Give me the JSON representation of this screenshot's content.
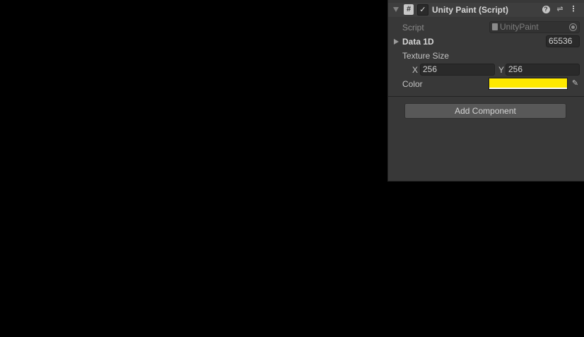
{
  "component": {
    "title": "Unity Paint (Script)",
    "enabled_check": "✓",
    "script_icon_glyph": "#",
    "help_glyph": "?",
    "presets_glyph": "⇌",
    "menu_glyph": "⋮"
  },
  "fields": {
    "script": {
      "label": "Script",
      "value": "UnityPaint"
    },
    "data1d": {
      "label": "Data 1D",
      "value": "65536"
    },
    "texture_size": {
      "label": "Texture Size",
      "x_label": "X",
      "x_value": "256",
      "y_label": "Y",
      "y_value": "256"
    },
    "color": {
      "label": "Color",
      "value_hex": "#ffe900",
      "eyedropper_glyph": "✎"
    }
  },
  "add_component_label": "Add Component"
}
